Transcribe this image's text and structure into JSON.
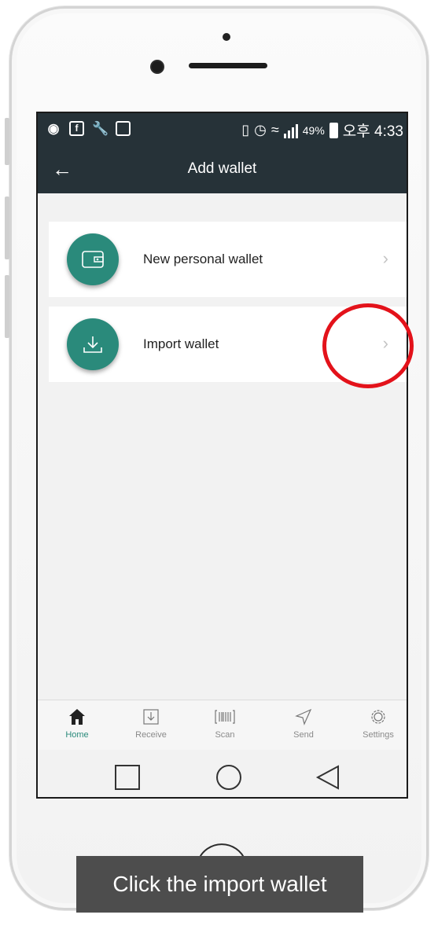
{
  "status_bar": {
    "battery_percent": "49%",
    "time": "오후 4:33"
  },
  "header": {
    "title": "Add wallet",
    "back_icon": "arrow-left-icon"
  },
  "options": [
    {
      "label": "New personal wallet",
      "icon": "wallet-icon"
    },
    {
      "label": "Import wallet",
      "icon": "download-icon"
    }
  ],
  "bottom_nav": [
    {
      "label": "Home",
      "icon": "home-icon",
      "active": true
    },
    {
      "label": "Receive",
      "icon": "receive-icon",
      "active": false
    },
    {
      "label": "Scan",
      "icon": "barcode-icon",
      "active": false
    },
    {
      "label": "Send",
      "icon": "send-icon",
      "active": false
    },
    {
      "label": "Settings",
      "icon": "gear-icon",
      "active": false
    }
  ],
  "caption": "Click the import wallet",
  "colors": {
    "appbar": "#263238",
    "accent": "#2a8a7b",
    "highlight_ring": "#e3121a"
  }
}
